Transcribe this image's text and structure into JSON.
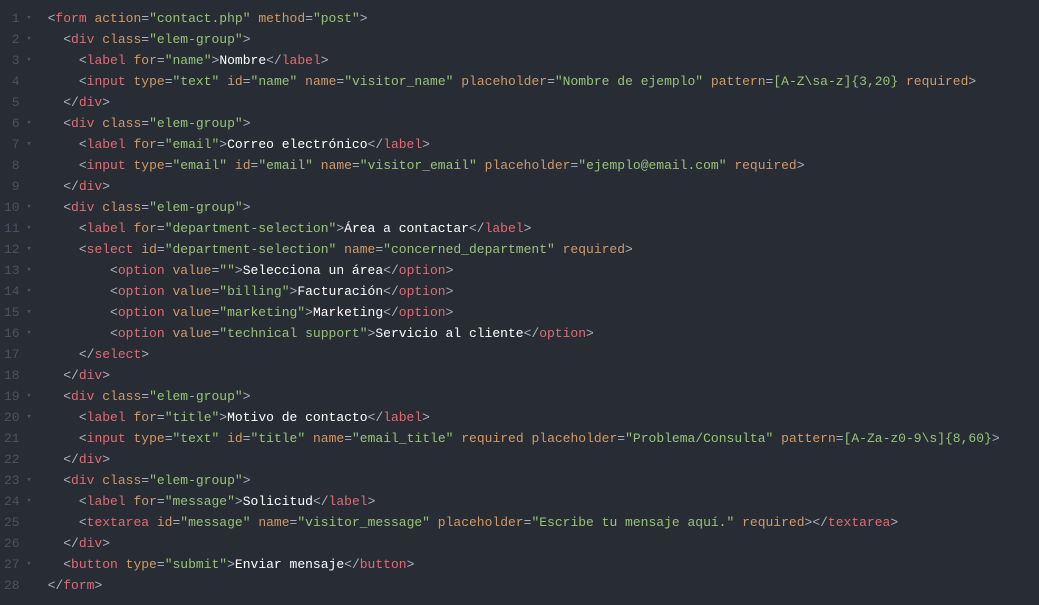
{
  "lines": [
    {
      "num": "1",
      "fold": true,
      "indent": 0,
      "tokens": [
        [
          "punct",
          "<"
        ],
        [
          "tag",
          "form"
        ],
        [
          "punct",
          " "
        ],
        [
          "attr",
          "action"
        ],
        [
          "eq",
          "="
        ],
        [
          "str",
          "\"contact.php\""
        ],
        [
          "punct",
          " "
        ],
        [
          "attr",
          "method"
        ],
        [
          "eq",
          "="
        ],
        [
          "str",
          "\"post\""
        ],
        [
          "punct",
          ">"
        ]
      ]
    },
    {
      "num": "2",
      "fold": true,
      "indent": 1,
      "tokens": [
        [
          "punct",
          "<"
        ],
        [
          "tag",
          "div"
        ],
        [
          "punct",
          " "
        ],
        [
          "attr",
          "class"
        ],
        [
          "eq",
          "="
        ],
        [
          "str",
          "\"elem-group\""
        ],
        [
          "punct",
          ">"
        ]
      ]
    },
    {
      "num": "3",
      "fold": true,
      "indent": 2,
      "tokens": [
        [
          "punct",
          "<"
        ],
        [
          "tag",
          "label"
        ],
        [
          "punct",
          " "
        ],
        [
          "attr",
          "for"
        ],
        [
          "eq",
          "="
        ],
        [
          "str",
          "\"name\""
        ],
        [
          "punct",
          ">"
        ],
        [
          "text",
          "Nombre"
        ],
        [
          "punct",
          "</"
        ],
        [
          "tag",
          "label"
        ],
        [
          "punct",
          ">"
        ]
      ]
    },
    {
      "num": "4",
      "fold": false,
      "indent": 2,
      "tokens": [
        [
          "punct",
          "<"
        ],
        [
          "tag",
          "input"
        ],
        [
          "punct",
          " "
        ],
        [
          "attr",
          "type"
        ],
        [
          "eq",
          "="
        ],
        [
          "str",
          "\"text\""
        ],
        [
          "punct",
          " "
        ],
        [
          "attr",
          "id"
        ],
        [
          "eq",
          "="
        ],
        [
          "str",
          "\"name\""
        ],
        [
          "punct",
          " "
        ],
        [
          "attr",
          "name"
        ],
        [
          "eq",
          "="
        ],
        [
          "str",
          "\"visitor_name\""
        ],
        [
          "punct",
          " "
        ],
        [
          "attr",
          "placeholder"
        ],
        [
          "eq",
          "="
        ],
        [
          "str",
          "\"Nombre de ejemplo\""
        ],
        [
          "punct",
          " "
        ],
        [
          "attr",
          "pattern"
        ],
        [
          "eq",
          "="
        ],
        [
          "str",
          "[A-Z\\sa-z]{3,20}"
        ],
        [
          "punct",
          " "
        ],
        [
          "attr",
          "required"
        ],
        [
          "punct",
          ">"
        ]
      ]
    },
    {
      "num": "5",
      "fold": false,
      "indent": 1,
      "tokens": [
        [
          "punct",
          "</"
        ],
        [
          "tag",
          "div"
        ],
        [
          "punct",
          ">"
        ]
      ]
    },
    {
      "num": "6",
      "fold": true,
      "indent": 1,
      "tokens": [
        [
          "punct",
          "<"
        ],
        [
          "tag",
          "div"
        ],
        [
          "punct",
          " "
        ],
        [
          "attr",
          "class"
        ],
        [
          "eq",
          "="
        ],
        [
          "str",
          "\"elem-group\""
        ],
        [
          "punct",
          ">"
        ]
      ]
    },
    {
      "num": "7",
      "fold": true,
      "indent": 2,
      "tokens": [
        [
          "punct",
          "<"
        ],
        [
          "tag",
          "label"
        ],
        [
          "punct",
          " "
        ],
        [
          "attr",
          "for"
        ],
        [
          "eq",
          "="
        ],
        [
          "str",
          "\"email\""
        ],
        [
          "punct",
          ">"
        ],
        [
          "text",
          "Correo electrónico"
        ],
        [
          "punct",
          "</"
        ],
        [
          "tag",
          "label"
        ],
        [
          "punct",
          ">"
        ]
      ]
    },
    {
      "num": "8",
      "fold": false,
      "indent": 2,
      "tokens": [
        [
          "punct",
          "<"
        ],
        [
          "tag",
          "input"
        ],
        [
          "punct",
          " "
        ],
        [
          "attr",
          "type"
        ],
        [
          "eq",
          "="
        ],
        [
          "str",
          "\"email\""
        ],
        [
          "punct",
          " "
        ],
        [
          "attr",
          "id"
        ],
        [
          "eq",
          "="
        ],
        [
          "str",
          "\"email\""
        ],
        [
          "punct",
          " "
        ],
        [
          "attr",
          "name"
        ],
        [
          "eq",
          "="
        ],
        [
          "str",
          "\"visitor_email\""
        ],
        [
          "punct",
          " "
        ],
        [
          "attr",
          "placeholder"
        ],
        [
          "eq",
          "="
        ],
        [
          "str",
          "\"ejemplo@email.com\""
        ],
        [
          "punct",
          " "
        ],
        [
          "attr",
          "required"
        ],
        [
          "punct",
          ">"
        ]
      ]
    },
    {
      "num": "9",
      "fold": false,
      "indent": 1,
      "tokens": [
        [
          "punct",
          "</"
        ],
        [
          "tag",
          "div"
        ],
        [
          "punct",
          ">"
        ]
      ]
    },
    {
      "num": "10",
      "fold": true,
      "indent": 1,
      "tokens": [
        [
          "punct",
          "<"
        ],
        [
          "tag",
          "div"
        ],
        [
          "punct",
          " "
        ],
        [
          "attr",
          "class"
        ],
        [
          "eq",
          "="
        ],
        [
          "str",
          "\"elem-group\""
        ],
        [
          "punct",
          ">"
        ]
      ]
    },
    {
      "num": "11",
      "fold": true,
      "indent": 2,
      "tokens": [
        [
          "punct",
          "<"
        ],
        [
          "tag",
          "label"
        ],
        [
          "punct",
          " "
        ],
        [
          "attr",
          "for"
        ],
        [
          "eq",
          "="
        ],
        [
          "str",
          "\"department-selection\""
        ],
        [
          "punct",
          ">"
        ],
        [
          "text",
          "Área a contactar"
        ],
        [
          "punct",
          "</"
        ],
        [
          "tag",
          "label"
        ],
        [
          "punct",
          ">"
        ]
      ]
    },
    {
      "num": "12",
      "fold": true,
      "indent": 2,
      "tokens": [
        [
          "punct",
          "<"
        ],
        [
          "tag",
          "select"
        ],
        [
          "punct",
          " "
        ],
        [
          "attr",
          "id"
        ],
        [
          "eq",
          "="
        ],
        [
          "str",
          "\"department-selection\""
        ],
        [
          "punct",
          " "
        ],
        [
          "attr",
          "name"
        ],
        [
          "eq",
          "="
        ],
        [
          "str",
          "\"concerned_department\""
        ],
        [
          "punct",
          " "
        ],
        [
          "attr",
          "required"
        ],
        [
          "punct",
          ">"
        ]
      ]
    },
    {
      "num": "13",
      "fold": true,
      "indent": 3,
      "tokens": [
        [
          "punct",
          "<"
        ],
        [
          "tag",
          "option"
        ],
        [
          "punct",
          " "
        ],
        [
          "attr",
          "value"
        ],
        [
          "eq",
          "="
        ],
        [
          "str",
          "\"\""
        ],
        [
          "punct",
          ">"
        ],
        [
          "text",
          "Selecciona un área"
        ],
        [
          "punct",
          "</"
        ],
        [
          "tag",
          "option"
        ],
        [
          "punct",
          ">"
        ]
      ]
    },
    {
      "num": "14",
      "fold": true,
      "indent": 3,
      "tokens": [
        [
          "punct",
          "<"
        ],
        [
          "tag",
          "option"
        ],
        [
          "punct",
          " "
        ],
        [
          "attr",
          "value"
        ],
        [
          "eq",
          "="
        ],
        [
          "str",
          "\"billing\""
        ],
        [
          "punct",
          ">"
        ],
        [
          "text",
          "Facturación"
        ],
        [
          "punct",
          "</"
        ],
        [
          "tag",
          "option"
        ],
        [
          "punct",
          ">"
        ]
      ]
    },
    {
      "num": "15",
      "fold": true,
      "indent": 3,
      "tokens": [
        [
          "punct",
          "<"
        ],
        [
          "tag",
          "option"
        ],
        [
          "punct",
          " "
        ],
        [
          "attr",
          "value"
        ],
        [
          "eq",
          "="
        ],
        [
          "str",
          "\"marketing\""
        ],
        [
          "punct",
          ">"
        ],
        [
          "text",
          "Marketing"
        ],
        [
          "punct",
          "</"
        ],
        [
          "tag",
          "option"
        ],
        [
          "punct",
          ">"
        ]
      ]
    },
    {
      "num": "16",
      "fold": true,
      "indent": 3,
      "tokens": [
        [
          "punct",
          "<"
        ],
        [
          "tag",
          "option"
        ],
        [
          "punct",
          " "
        ],
        [
          "attr",
          "value"
        ],
        [
          "eq",
          "="
        ],
        [
          "str",
          "\"technical support\""
        ],
        [
          "punct",
          ">"
        ],
        [
          "text",
          "Servicio al cliente"
        ],
        [
          "punct",
          "</"
        ],
        [
          "tag",
          "option"
        ],
        [
          "punct",
          ">"
        ]
      ]
    },
    {
      "num": "17",
      "fold": false,
      "indent": 2,
      "tokens": [
        [
          "punct",
          "</"
        ],
        [
          "tag",
          "select"
        ],
        [
          "punct",
          ">"
        ]
      ]
    },
    {
      "num": "18",
      "fold": false,
      "indent": 1,
      "tokens": [
        [
          "punct",
          "</"
        ],
        [
          "tag",
          "div"
        ],
        [
          "punct",
          ">"
        ]
      ]
    },
    {
      "num": "19",
      "fold": true,
      "indent": 1,
      "tokens": [
        [
          "punct",
          "<"
        ],
        [
          "tag",
          "div"
        ],
        [
          "punct",
          " "
        ],
        [
          "attr",
          "class"
        ],
        [
          "eq",
          "="
        ],
        [
          "str",
          "\"elem-group\""
        ],
        [
          "punct",
          ">"
        ]
      ]
    },
    {
      "num": "20",
      "fold": true,
      "indent": 2,
      "tokens": [
        [
          "punct",
          "<"
        ],
        [
          "tag",
          "label"
        ],
        [
          "punct",
          " "
        ],
        [
          "attr",
          "for"
        ],
        [
          "eq",
          "="
        ],
        [
          "str",
          "\"title\""
        ],
        [
          "punct",
          ">"
        ],
        [
          "text",
          "Motivo de contacto"
        ],
        [
          "punct",
          "</"
        ],
        [
          "tag",
          "label"
        ],
        [
          "punct",
          ">"
        ]
      ]
    },
    {
      "num": "21",
      "fold": false,
      "indent": 2,
      "tokens": [
        [
          "punct",
          "<"
        ],
        [
          "tag",
          "input"
        ],
        [
          "punct",
          " "
        ],
        [
          "attr",
          "type"
        ],
        [
          "eq",
          "="
        ],
        [
          "str",
          "\"text\""
        ],
        [
          "punct",
          " "
        ],
        [
          "attr",
          "id"
        ],
        [
          "eq",
          "="
        ],
        [
          "str",
          "\"title\""
        ],
        [
          "punct",
          " "
        ],
        [
          "attr",
          "name"
        ],
        [
          "eq",
          "="
        ],
        [
          "str",
          "\"email_title\""
        ],
        [
          "punct",
          " "
        ],
        [
          "attr",
          "required"
        ],
        [
          "punct",
          " "
        ],
        [
          "attr",
          "placeholder"
        ],
        [
          "eq",
          "="
        ],
        [
          "str",
          "\"Problema/Consulta\""
        ],
        [
          "punct",
          " "
        ],
        [
          "attr",
          "pattern"
        ],
        [
          "eq",
          "="
        ],
        [
          "str",
          "[A-Za-z0-9\\s]{8,60}"
        ],
        [
          "punct",
          ">"
        ]
      ]
    },
    {
      "num": "22",
      "fold": false,
      "indent": 1,
      "tokens": [
        [
          "punct",
          "</"
        ],
        [
          "tag",
          "div"
        ],
        [
          "punct",
          ">"
        ]
      ]
    },
    {
      "num": "23",
      "fold": true,
      "indent": 1,
      "tokens": [
        [
          "punct",
          "<"
        ],
        [
          "tag",
          "div"
        ],
        [
          "punct",
          " "
        ],
        [
          "attr",
          "class"
        ],
        [
          "eq",
          "="
        ],
        [
          "str",
          "\"elem-group\""
        ],
        [
          "punct",
          ">"
        ]
      ]
    },
    {
      "num": "24",
      "fold": true,
      "indent": 2,
      "tokens": [
        [
          "punct",
          "<"
        ],
        [
          "tag",
          "label"
        ],
        [
          "punct",
          " "
        ],
        [
          "attr",
          "for"
        ],
        [
          "eq",
          "="
        ],
        [
          "str",
          "\"message\""
        ],
        [
          "punct",
          ">"
        ],
        [
          "text",
          "Solicitud"
        ],
        [
          "punct",
          "</"
        ],
        [
          "tag",
          "label"
        ],
        [
          "punct",
          ">"
        ]
      ]
    },
    {
      "num": "25",
      "fold": false,
      "indent": 2,
      "tokens": [
        [
          "punct",
          "<"
        ],
        [
          "tag",
          "textarea"
        ],
        [
          "punct",
          " "
        ],
        [
          "attr",
          "id"
        ],
        [
          "eq",
          "="
        ],
        [
          "str",
          "\"message\""
        ],
        [
          "punct",
          " "
        ],
        [
          "attr",
          "name"
        ],
        [
          "eq",
          "="
        ],
        [
          "str",
          "\"visitor_message\""
        ],
        [
          "punct",
          " "
        ],
        [
          "attr",
          "placeholder"
        ],
        [
          "eq",
          "="
        ],
        [
          "str",
          "\"Escribe tu mensaje aquí.\""
        ],
        [
          "punct",
          " "
        ],
        [
          "attr",
          "required"
        ],
        [
          "punct",
          "></"
        ],
        [
          "tag",
          "textarea"
        ],
        [
          "punct",
          ">"
        ]
      ]
    },
    {
      "num": "26",
      "fold": false,
      "indent": 1,
      "tokens": [
        [
          "punct",
          "</"
        ],
        [
          "tag",
          "div"
        ],
        [
          "punct",
          ">"
        ]
      ]
    },
    {
      "num": "27",
      "fold": true,
      "indent": 1,
      "tokens": [
        [
          "punct",
          "<"
        ],
        [
          "tag",
          "button"
        ],
        [
          "punct",
          " "
        ],
        [
          "attr",
          "type"
        ],
        [
          "eq",
          "="
        ],
        [
          "str",
          "\"submit\""
        ],
        [
          "punct",
          ">"
        ],
        [
          "text",
          "Enviar mensaje"
        ],
        [
          "punct",
          "</"
        ],
        [
          "tag",
          "button"
        ],
        [
          "punct",
          ">"
        ]
      ]
    },
    {
      "num": "28",
      "fold": false,
      "indent": 0,
      "tokens": [
        [
          "punct",
          "</"
        ],
        [
          "tag",
          "form"
        ],
        [
          "punct",
          ">"
        ]
      ]
    }
  ],
  "indentUnit": "  ",
  "optionIndent": "    "
}
